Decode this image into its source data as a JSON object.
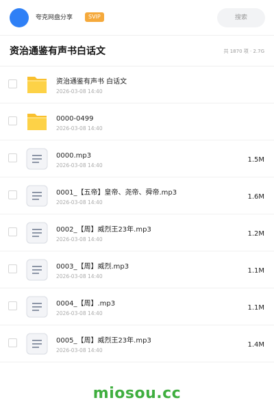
{
  "header": {
    "user_name": "夸克网盘分享",
    "badge": "SVIP",
    "search_label": "搜索",
    "avatar_color": "#2f80f6",
    "badge_color": "#f5a93b"
  },
  "folder": {
    "title": "资治通鉴有声书白话文",
    "meta": "共 1870 项 · 2.7G"
  },
  "files": [
    {
      "type": "folder",
      "icon": "folder-icon",
      "name": "资治通鉴有声书 白话文",
      "date": "2026-03-08 14:40",
      "size": ""
    },
    {
      "type": "folder",
      "icon": "folder-icon",
      "name": "0000-0499",
      "date": "2026-03-08 14:40",
      "size": ""
    },
    {
      "type": "file",
      "icon": "audio-file-icon",
      "name": "0000.mp3",
      "date": "2026-03-08 14:40",
      "size": "1.5M"
    },
    {
      "type": "file",
      "icon": "audio-file-icon",
      "name": "0001_【五帝】皇帝、尧帝、舜帝.mp3",
      "date": "2026-03-08 14:40",
      "size": "1.6M"
    },
    {
      "type": "file",
      "icon": "audio-file-icon",
      "name": "0002_【周】威烈王23年.mp3",
      "date": "2026-03-08 14:40",
      "size": "1.2M"
    },
    {
      "type": "file",
      "icon": "audio-file-icon",
      "name": "0003_【周】威烈.mp3",
      "date": "2026-03-08 14:40",
      "size": "1.1M"
    },
    {
      "type": "file",
      "icon": "audio-file-icon",
      "name": "0004_【周】.mp3",
      "date": "2026-03-08 14:40",
      "size": "1.1M"
    },
    {
      "type": "file",
      "icon": "audio-file-icon",
      "name": "0005_【周】威烈王23年.mp3",
      "date": "2026-03-08 14:40",
      "size": "1.4M"
    }
  ],
  "watermark": "miosou.cc",
  "watermark_color": "#3fae3f"
}
